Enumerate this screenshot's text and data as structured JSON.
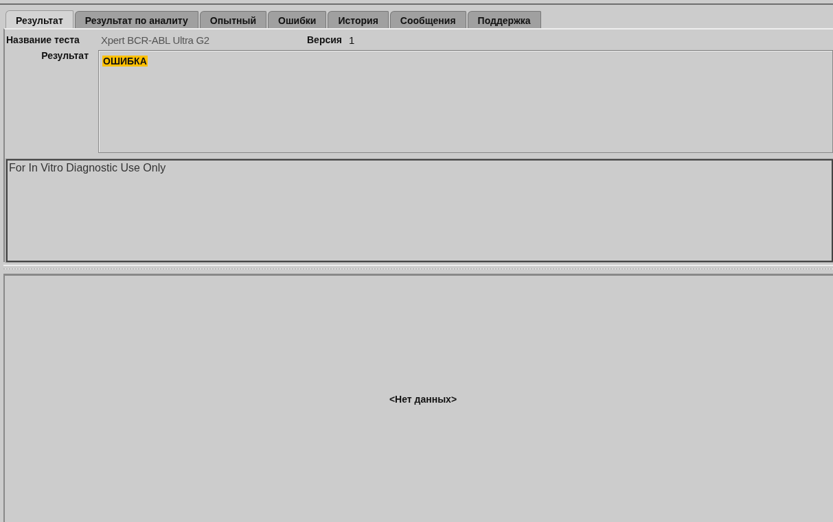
{
  "tabs": [
    {
      "label": "Результат",
      "selected": true
    },
    {
      "label": "Результат по аналиту",
      "selected": false
    },
    {
      "label": "Опытный",
      "selected": false
    },
    {
      "label": "Ошибки",
      "selected": false
    },
    {
      "label": "История",
      "selected": false
    },
    {
      "label": "Сообщения",
      "selected": false
    },
    {
      "label": "Поддержка",
      "selected": false
    }
  ],
  "test_name": {
    "label": "Название теста",
    "value": "Xpert BCR-ABL Ultra G2"
  },
  "version": {
    "label": "Версия",
    "value": "1"
  },
  "result": {
    "label": "Результат",
    "value": "ОШИБКА",
    "highlighted": true
  },
  "notice": "For In Vitro Diagnostic Use Only",
  "empty_message": "<Нет данных>"
}
